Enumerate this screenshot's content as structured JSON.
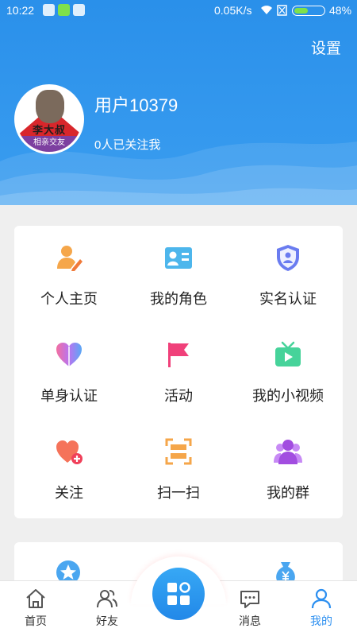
{
  "status_bar": {
    "time": "10:22",
    "network_speed": "0.05K/s",
    "battery": "48%",
    "battery_level": 0.48
  },
  "header": {
    "settings_label": "设置",
    "username": "用户10379",
    "followers_text": "0人已关注我",
    "avatar_text": "李大叔",
    "avatar_band_text": "相亲交友"
  },
  "menu": [
    {
      "label": "个人主页",
      "icon": "user-edit-icon",
      "color": "#f5a64a"
    },
    {
      "label": "我的角色",
      "icon": "id-card-icon",
      "color": "#4db6ec"
    },
    {
      "label": "实名认证",
      "icon": "shield-user-icon",
      "color": "#6a7cf0"
    },
    {
      "label": "单身认证",
      "icon": "heart-icon",
      "color": "#b874f0"
    },
    {
      "label": "活动",
      "icon": "flag-icon",
      "color": "#f0407a"
    },
    {
      "label": "我的小视频",
      "icon": "tv-play-icon",
      "color": "#46d39a"
    },
    {
      "label": "关注",
      "icon": "heart-plus-icon",
      "color": "#f5735a"
    },
    {
      "label": "扫一扫",
      "icon": "scan-icon",
      "color": "#f5a64a"
    },
    {
      "label": "我的群",
      "icon": "group-icon",
      "color": "#b35ce8"
    }
  ],
  "tabbar": {
    "items": [
      {
        "label": "首页",
        "icon": "home-icon"
      },
      {
        "label": "好友",
        "icon": "friends-icon"
      },
      {
        "label": "消息",
        "icon": "message-icon"
      },
      {
        "label": "我的",
        "icon": "profile-icon",
        "active": true
      }
    ],
    "accent": "#2c8ff0"
  }
}
